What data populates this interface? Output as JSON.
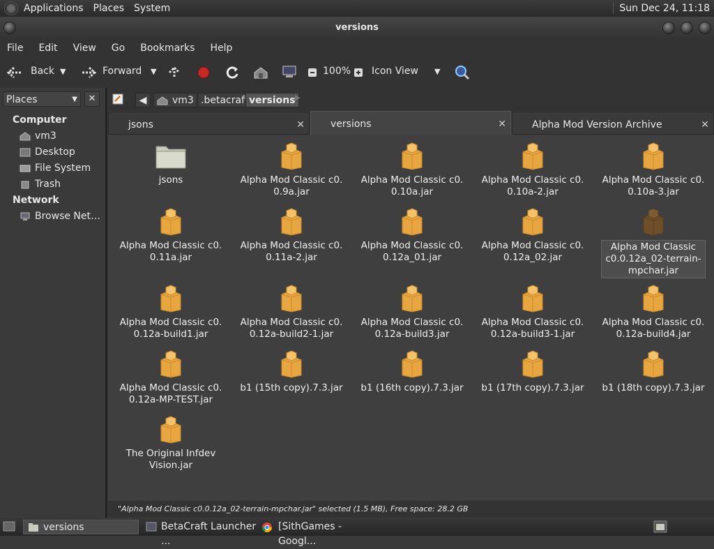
{
  "top_panel": {
    "menus": [
      "Applications",
      "Places",
      "System"
    ],
    "clock": "Sun Dec 24, 11:18"
  },
  "window": {
    "title": "versions"
  },
  "menubar": [
    "File",
    "Edit",
    "View",
    "Go",
    "Bookmarks",
    "Help"
  ],
  "toolbar": {
    "back": "Back",
    "forward": "Forward",
    "zoom": "100%",
    "view_mode": "Icon View"
  },
  "sidebar": {
    "selector": "Places",
    "computer_heading": "Computer",
    "computer_items": [
      "vm3",
      "Desktop",
      "File System",
      "Trash"
    ],
    "network_heading": "Network",
    "network_items": [
      "Browse Net…"
    ]
  },
  "pathbar": [
    "vm3",
    ".betacraft",
    "versions"
  ],
  "tabs": [
    "jsons",
    "versions",
    "Alpha Mod Version Archive"
  ],
  "files": [
    {
      "name": "jsons",
      "type": "folder"
    },
    {
      "name": "Alpha Mod Classic c0.\n0.9a.jar",
      "type": "jar"
    },
    {
      "name": "Alpha Mod Classic c0.\n0.10a.jar",
      "type": "jar"
    },
    {
      "name": "Alpha Mod Classic c0.\n0.10a-2.jar",
      "type": "jar"
    },
    {
      "name": "Alpha Mod Classic c0.\n0.10a-3.jar",
      "type": "jar"
    },
    {
      "name": "Alpha Mod Classic c0.\n0.11a.jar",
      "type": "jar"
    },
    {
      "name": "Alpha Mod Classic c0.\n0.11a-2.jar",
      "type": "jar"
    },
    {
      "name": "Alpha Mod Classic c0.\n0.12a_01.jar",
      "type": "jar"
    },
    {
      "name": "Alpha Mod Classic c0.\n0.12a_02.jar",
      "type": "jar"
    },
    {
      "name": "Alpha Mod Classic\nc0.0.12a_02-terrain-\nmpchar.jar",
      "type": "jar",
      "selected": true
    },
    {
      "name": "Alpha Mod Classic c0.\n0.12a-build1.jar",
      "type": "jar"
    },
    {
      "name": "Alpha Mod Classic c0.\n0.12a-build2-1.jar",
      "type": "jar"
    },
    {
      "name": "Alpha Mod Classic c0.\n0.12a-build3.jar",
      "type": "jar"
    },
    {
      "name": "Alpha Mod Classic c0.\n0.12a-build3-1.jar",
      "type": "jar"
    },
    {
      "name": "Alpha Mod Classic c0.\n0.12a-build4.jar",
      "type": "jar"
    },
    {
      "name": "Alpha Mod Classic c0.\n0.12a-MP-TEST.jar",
      "type": "jar"
    },
    {
      "name": "b1 (15th copy).7.3.jar",
      "type": "jar"
    },
    {
      "name": "b1 (16th copy).7.3.jar",
      "type": "jar"
    },
    {
      "name": "b1 (17th copy).7.3.jar",
      "type": "jar"
    },
    {
      "name": "b1 (18th copy).7.3.jar",
      "type": "jar"
    },
    {
      "name": "The Original Infdev\nVision.jar",
      "type": "jar"
    }
  ],
  "status": "\"Alpha Mod Classic c0.0.12a_02-terrain-mpchar.jar\" selected (1.5 MB), Free space: 28.2 GB",
  "taskbar": [
    "versions",
    "BetaCraft Launcher ...",
    "[SithGames - Googl..."
  ],
  "colors": {
    "jar": "#e8a640",
    "folder": "#c8cbbd",
    "selection": "#4d4d4d"
  }
}
